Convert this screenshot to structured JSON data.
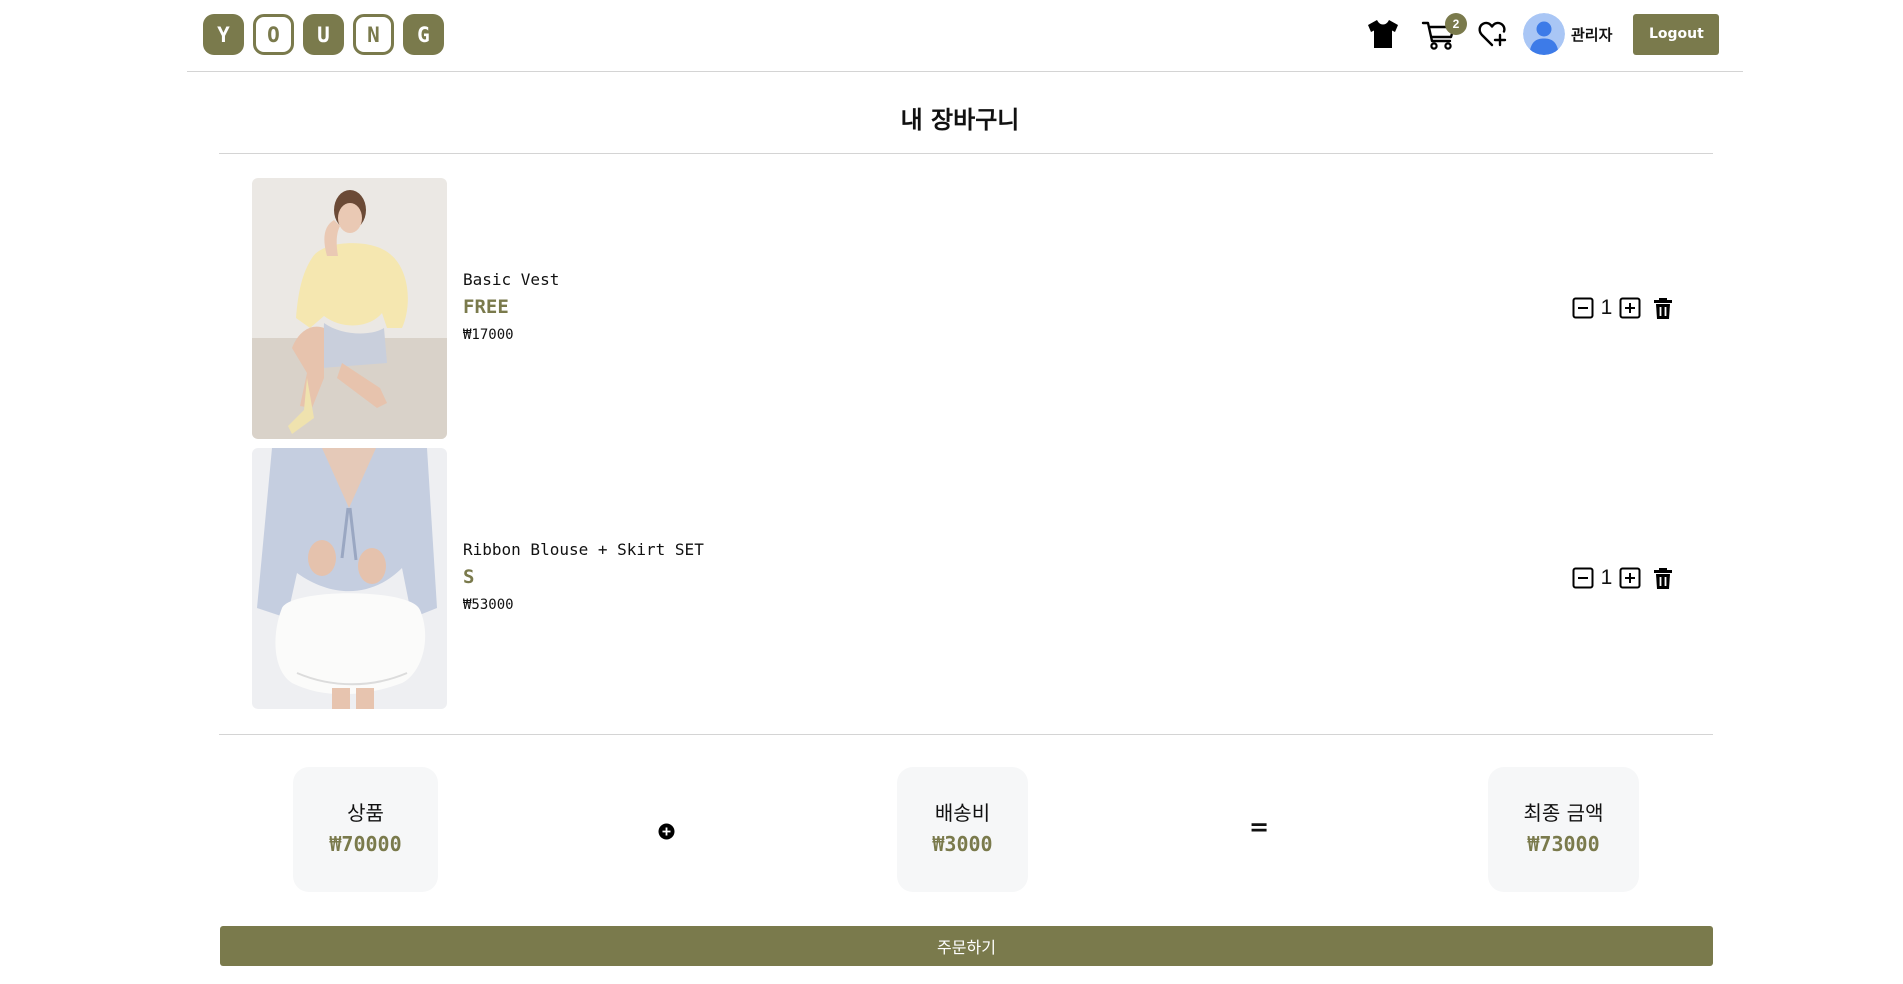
{
  "brand": {
    "logo_letters": [
      "Y",
      "O",
      "U",
      "N",
      "G"
    ]
  },
  "header": {
    "cart_count": "2",
    "user_name": "관리자",
    "logout_label": "Logout"
  },
  "page": {
    "title": "내 장바구니"
  },
  "cart": {
    "items": [
      {
        "name": "Basic Vest",
        "size": "FREE",
        "price": "₩17000",
        "quantity": "1"
      },
      {
        "name": "Ribbon Blouse + Skirt SET",
        "size": "S",
        "price": "₩53000",
        "quantity": "1"
      }
    ]
  },
  "summary": {
    "products_label": "상품",
    "products_value": "₩70000",
    "plus_symbol": "+",
    "shipping_label": "배송비",
    "shipping_value": "₩3000",
    "equals_symbol": "=",
    "total_label": "최종 금액",
    "total_value": "₩73000"
  },
  "order_button_label": "주문하기",
  "colors": {
    "accent": "#7a7a4c",
    "divider": "#d4d4d4",
    "summary_bg": "#f6f7f8"
  }
}
